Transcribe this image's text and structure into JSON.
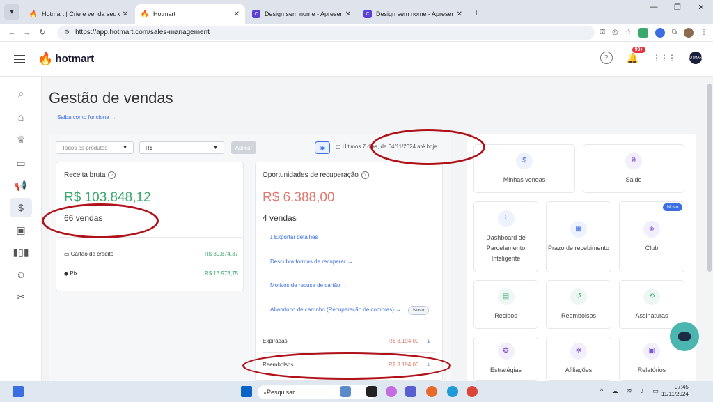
{
  "browser": {
    "tabs": [
      {
        "label": "Hotmart | Crie e venda seu curs",
        "favicon": "flame-icon",
        "active": false
      },
      {
        "label": "Hotmart",
        "favicon": "flame-icon",
        "active": true
      },
      {
        "label": "Design sem nome - Apresentaç",
        "favicon": "canva-icon",
        "active": false
      },
      {
        "label": "Design sem nome - Apresentaç",
        "favicon": "canva-icon",
        "active": false
      }
    ],
    "url": "https://app.hotmart.com/sales-management"
  },
  "header": {
    "logo": "hotmart",
    "notification_count": "99+",
    "avatar_text": "HOTMART"
  },
  "page": {
    "title": "Gestão de vendas",
    "help_link": "Saiba como funciona →"
  },
  "filters": {
    "products_placeholder": "Todos os produtos",
    "currency": "R$",
    "apply_label": "Aplicar",
    "period_text": "Últimos 7 dias, de 04/11/2024 até hoje"
  },
  "gross_revenue": {
    "title": "Receita bruta",
    "amount": "R$ 103.848,12",
    "sales": "66 vendas",
    "methods": [
      {
        "label": "Cartão de crédito",
        "value": "R$ 89.874,37"
      },
      {
        "label": "Pix",
        "value": "R$ 13.973,75"
      }
    ]
  },
  "recovery": {
    "title": "Oportunidades de recuperação",
    "amount": "R$ 6.388,00",
    "sales": "4 vendas",
    "export_label": "Exportar detalhes",
    "links": [
      "Descubra formas de recuperar →",
      "Motivos de recusa de cartão →",
      "Abandono de carrinho (Recuperação de compras) →"
    ],
    "new_badge": "Novo",
    "rows": [
      {
        "label": "Expiradas",
        "value": "R$ 3.194,00"
      },
      {
        "label": "Reembolsos",
        "value": "R$ 3.194,00"
      }
    ]
  },
  "shortcuts": {
    "new_badge": "Novo",
    "tiles": [
      {
        "label": "Minhas vendas",
        "icon": "dollar-icon"
      },
      {
        "label": "Saldo",
        "icon": "wallet-icon"
      },
      {
        "label": "Dashboard de Parcelamento Inteligente",
        "icon": "chart-line-icon"
      },
      {
        "label": "Prazo de recebimento",
        "icon": "calendar-icon"
      },
      {
        "label": "Club",
        "icon": "club-icon"
      },
      {
        "label": "Recibos",
        "icon": "receipt-icon"
      },
      {
        "label": "Reembolsos",
        "icon": "refund-icon"
      },
      {
        "label": "Assinaturas",
        "icon": "repeat-icon"
      },
      {
        "label": "Estratégias",
        "icon": "lightbulb-icon"
      },
      {
        "label": "Afiliações",
        "icon": "network-icon"
      },
      {
        "label": "Relatórios",
        "icon": "report-icon"
      }
    ]
  },
  "taskbar": {
    "search_label": "Pesquisar",
    "time": "07:45",
    "date": "11/11/2024"
  },
  "colors": {
    "green": "#3aa76d",
    "red_value": "#e07a6f",
    "link_blue": "#3b6ee0",
    "annotation_red": "#b0121a",
    "brand_orange": "#f04e23"
  }
}
